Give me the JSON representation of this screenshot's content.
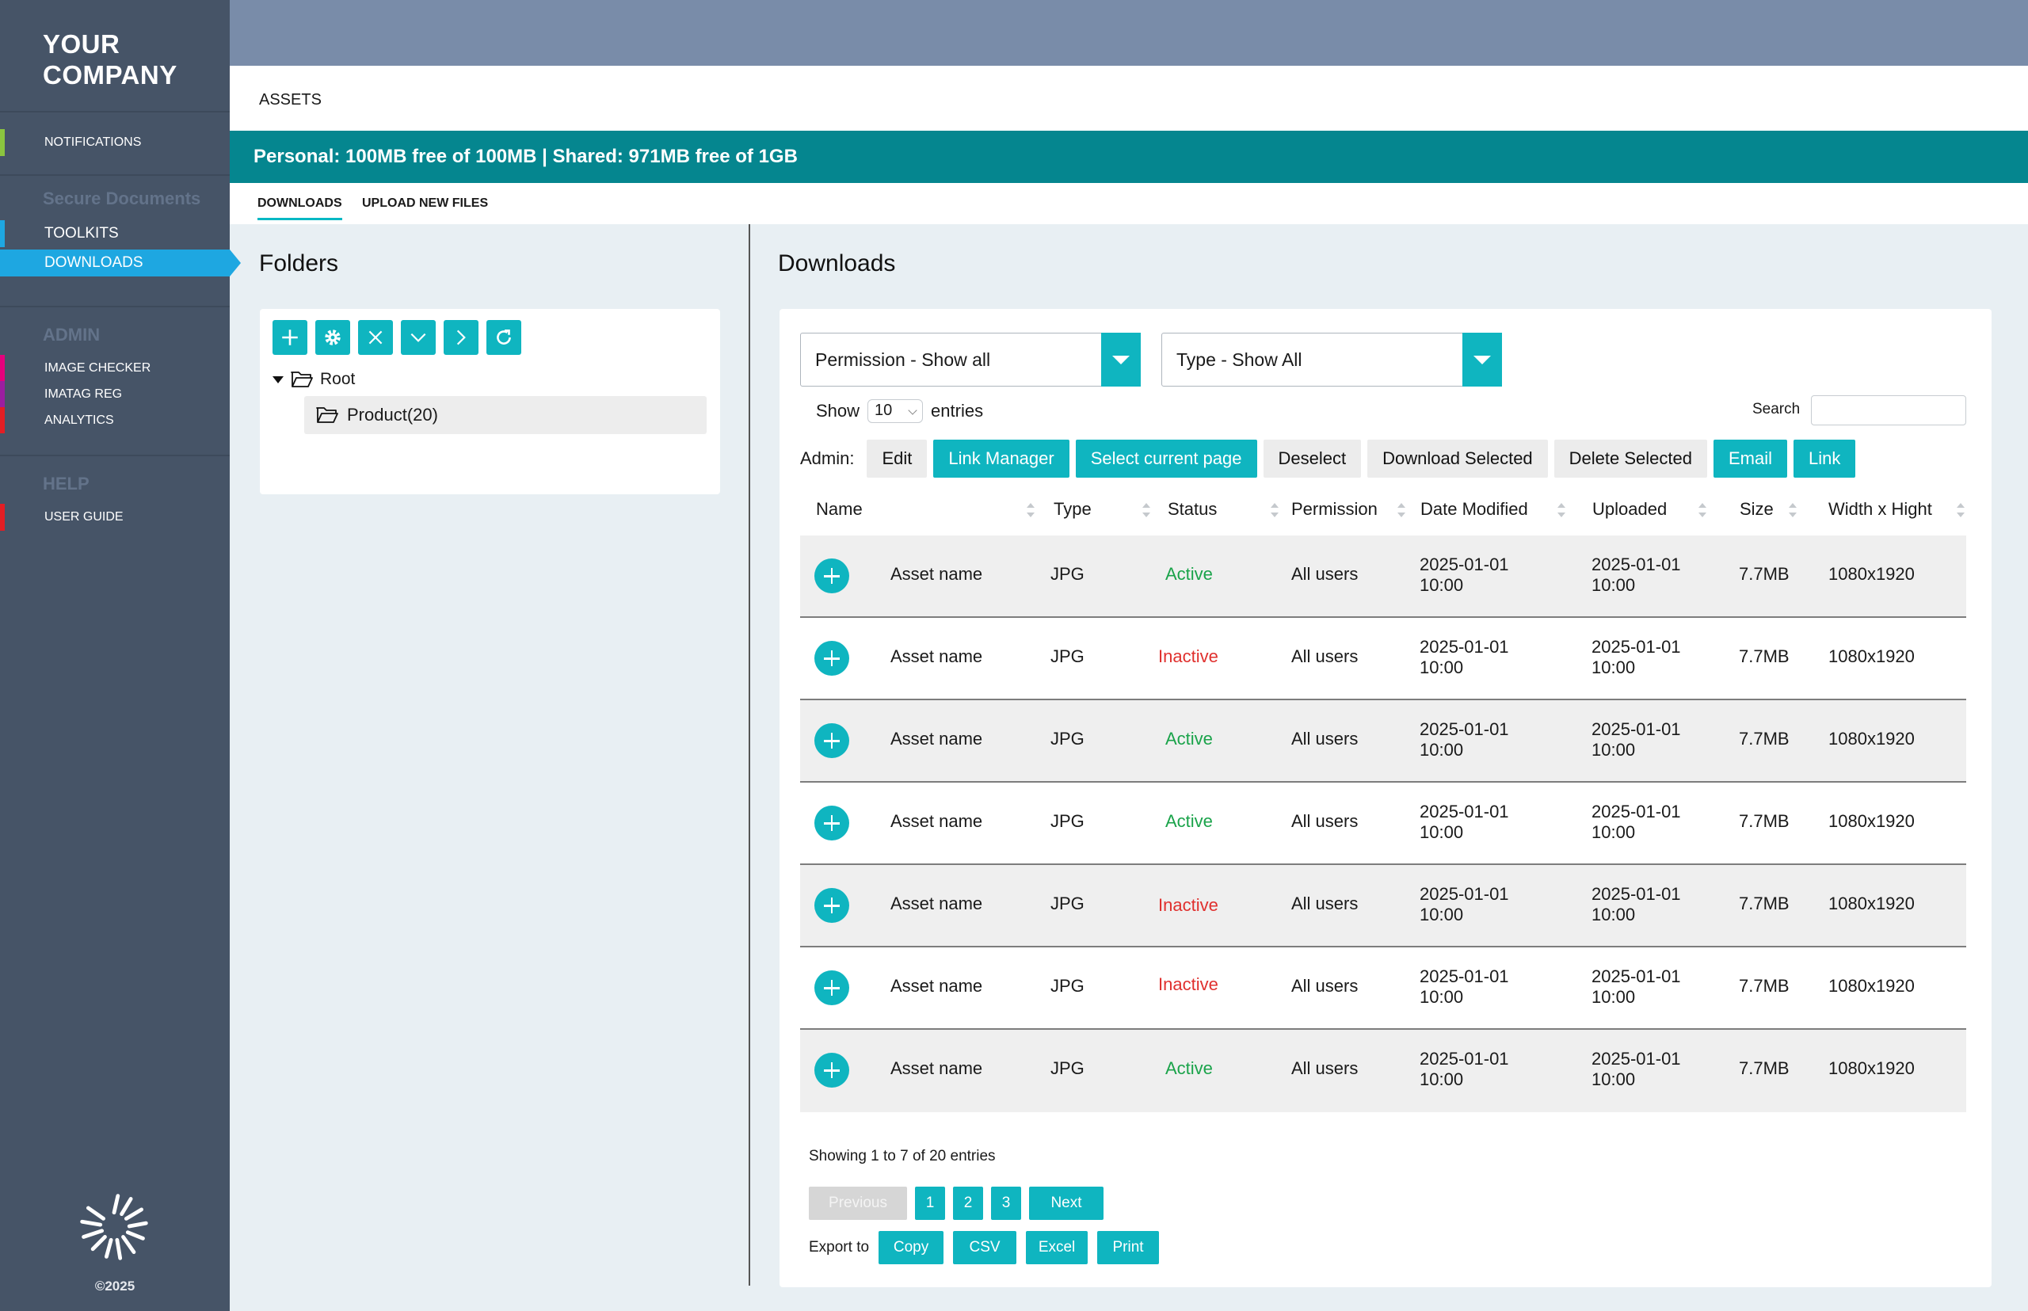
{
  "sidebar": {
    "logo_line1": "YOUR",
    "logo_line2": "COMPANY",
    "notifications": "NOTIFICATIONS",
    "section_secure": "Secure Documents",
    "toolkits": "TOOLKITS",
    "downloads": "DOWNLOADS",
    "section_admin": "ADMIN",
    "image_checker": "IMAGE CHECKER",
    "imatag_reg": "IMATAG REG",
    "analytics": "ANALYTICS",
    "section_help": "HELP",
    "user_guide": "USER GUIDE",
    "copyright": "©2025",
    "bar_colors": {
      "notifications": "#8bc53f",
      "toolkits": "#1ea7e1",
      "image_checker": "#e4007c",
      "imatag_reg": "#9b1ea0",
      "analytics": "#e31e24",
      "user_guide": "#e31e24"
    }
  },
  "header": {
    "assets_title": "ASSETS",
    "quota": "Personal: 100MB free of 100MB | Shared: 971MB free of 1GB",
    "tabs": [
      "DOWNLOADS",
      "UPLOAD NEW FILES"
    ]
  },
  "folders": {
    "title": "Folders",
    "tools": [
      "add-icon",
      "gear-icon",
      "close-icon",
      "chevron-down-icon",
      "chevron-right-icon",
      "refresh-icon"
    ],
    "root": "Root",
    "child": "Product(20)"
  },
  "downloads": {
    "title": "Downloads",
    "permission_filter": "Permission - Show all",
    "type_filter": "Type - Show All",
    "show_label": "Show",
    "entries_value": "10",
    "entries_label": "entries",
    "search_label": "Search",
    "admin_label": "Admin:",
    "admin_buttons": {
      "edit": "Edit",
      "link_manager": "Link Manager",
      "select_page": "Select current page",
      "deselect": "Deselect",
      "download_selected": "Download Selected",
      "delete_selected": "Delete Selected",
      "email": "Email",
      "link": "Link"
    },
    "columns": [
      "Name",
      "Type",
      "Status",
      "Permission",
      "Date Modified",
      "Uploaded",
      "Size",
      "Width x Hight"
    ],
    "rows": [
      {
        "name": "Asset name",
        "type": "JPG",
        "status": "Active",
        "permission": "All users",
        "modified_date": "2025-01-01",
        "modified_time": "10:00",
        "uploaded_date": "2025-01-01",
        "uploaded_time": "10:00",
        "size": "7.7MB",
        "dims": "1080x1920"
      },
      {
        "name": "Asset name",
        "type": "JPG",
        "status": "Inactive",
        "permission": "All users",
        "modified_date": "2025-01-01",
        "modified_time": "10:00",
        "uploaded_date": "2025-01-01",
        "uploaded_time": "10:00",
        "size": "7.7MB",
        "dims": "1080x1920"
      },
      {
        "name": "Asset name",
        "type": "JPG",
        "status": "Active",
        "permission": "All users",
        "modified_date": "2025-01-01",
        "modified_time": "10:00",
        "uploaded_date": "2025-01-01",
        "uploaded_time": "10:00",
        "size": "7.7MB",
        "dims": "1080x1920"
      },
      {
        "name": "Asset name",
        "type": "JPG",
        "status": "Active",
        "permission": "All users",
        "modified_date": "2025-01-01",
        "modified_time": "10:00",
        "uploaded_date": "2025-01-01",
        "uploaded_time": "10:00",
        "size": "7.7MB",
        "dims": "1080x1920"
      },
      {
        "name": "Asset name",
        "type": "JPG",
        "status": "Inactive",
        "permission": "All users",
        "modified_date": "2025-01-01",
        "modified_time": "10:00",
        "uploaded_date": "2025-01-01",
        "uploaded_time": "10:00",
        "size": "7.7MB",
        "dims": "1080x1920"
      },
      {
        "name": "Asset name",
        "type": "JPG",
        "status": "Inactive",
        "permission": "All users",
        "modified_date": "2025-01-01",
        "modified_time": "10:00",
        "uploaded_date": "2025-01-01",
        "uploaded_time": "10:00",
        "size": "7.7MB",
        "dims": "1080x1920"
      },
      {
        "name": "Asset name",
        "type": "JPG",
        "status": "Active",
        "permission": "All users",
        "modified_date": "2025-01-01",
        "modified_time": "10:00",
        "uploaded_date": "2025-01-01",
        "uploaded_time": "10:00",
        "size": "7.7MB",
        "dims": "1080x1920"
      }
    ],
    "showing": "Showing 1 to 7 of 20 entries",
    "pager": {
      "previous": "Previous",
      "pages": [
        "1",
        "2",
        "3"
      ],
      "next": "Next"
    },
    "export_label": "Export to",
    "export_buttons": [
      "Copy",
      "CSV",
      "Excel",
      "Print"
    ]
  },
  "colors": {
    "teal": "#0fb5c0",
    "quota_bar": "#05868f",
    "sidebar": "#465467",
    "topbar": "#798ca9",
    "active_nav": "#1ea7e1",
    "status_active": "#1aa34a",
    "status_inactive": "#e0302e"
  }
}
